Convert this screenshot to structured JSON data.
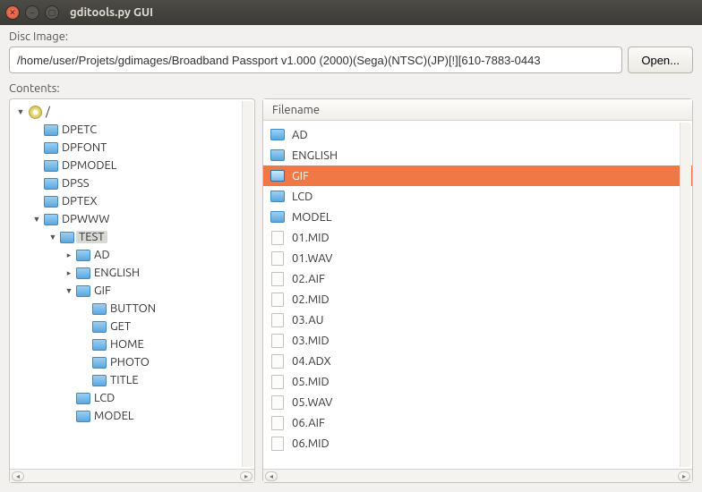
{
  "window": {
    "title": "gditools.py GUI"
  },
  "labels": {
    "disc_image": "Disc Image:",
    "contents": "Contents:"
  },
  "path": {
    "value": "/home/user/Projets/gdimages/Broadband Passport v1.000 (2000)(Sega)(NTSC)(JP)[!][610-7883-0443",
    "open_label": "Open..."
  },
  "filelist": {
    "header": "Filename",
    "items": [
      {
        "name": "AD",
        "type": "folder",
        "selected": false
      },
      {
        "name": "ENGLISH",
        "type": "folder",
        "selected": false
      },
      {
        "name": "GIF",
        "type": "folder",
        "selected": true
      },
      {
        "name": "LCD",
        "type": "folder",
        "selected": false
      },
      {
        "name": "MODEL",
        "type": "folder",
        "selected": false
      },
      {
        "name": "01.MID",
        "type": "file",
        "selected": false
      },
      {
        "name": "01.WAV",
        "type": "file",
        "selected": false
      },
      {
        "name": "02.AIF",
        "type": "file",
        "selected": false
      },
      {
        "name": "02.MID",
        "type": "file",
        "selected": false
      },
      {
        "name": "03.AU",
        "type": "file",
        "selected": false
      },
      {
        "name": "03.MID",
        "type": "file",
        "selected": false
      },
      {
        "name": "04.ADX",
        "type": "file",
        "selected": false
      },
      {
        "name": "05.MID",
        "type": "file",
        "selected": false
      },
      {
        "name": "05.WAV",
        "type": "file",
        "selected": false
      },
      {
        "name": "06.AIF",
        "type": "file",
        "selected": false
      },
      {
        "name": "06.MID",
        "type": "file",
        "selected": false
      }
    ]
  },
  "tree": {
    "root_label": "/",
    "nodes": {
      "dpetc": "DPETC",
      "dpfont": "DPFONT",
      "dpmodel": "DPMODEL",
      "dpss": "DPSS",
      "dptex": "DPTEX",
      "dpwww": "DPWWW",
      "test": "TEST",
      "ad": "AD",
      "english": "ENGLISH",
      "gif": "GIF",
      "button": "BUTTON",
      "get": "GET",
      "home": "HOME",
      "photo": "PHOTO",
      "title": "TITLE",
      "lcd": "LCD",
      "model": "MODEL"
    }
  }
}
